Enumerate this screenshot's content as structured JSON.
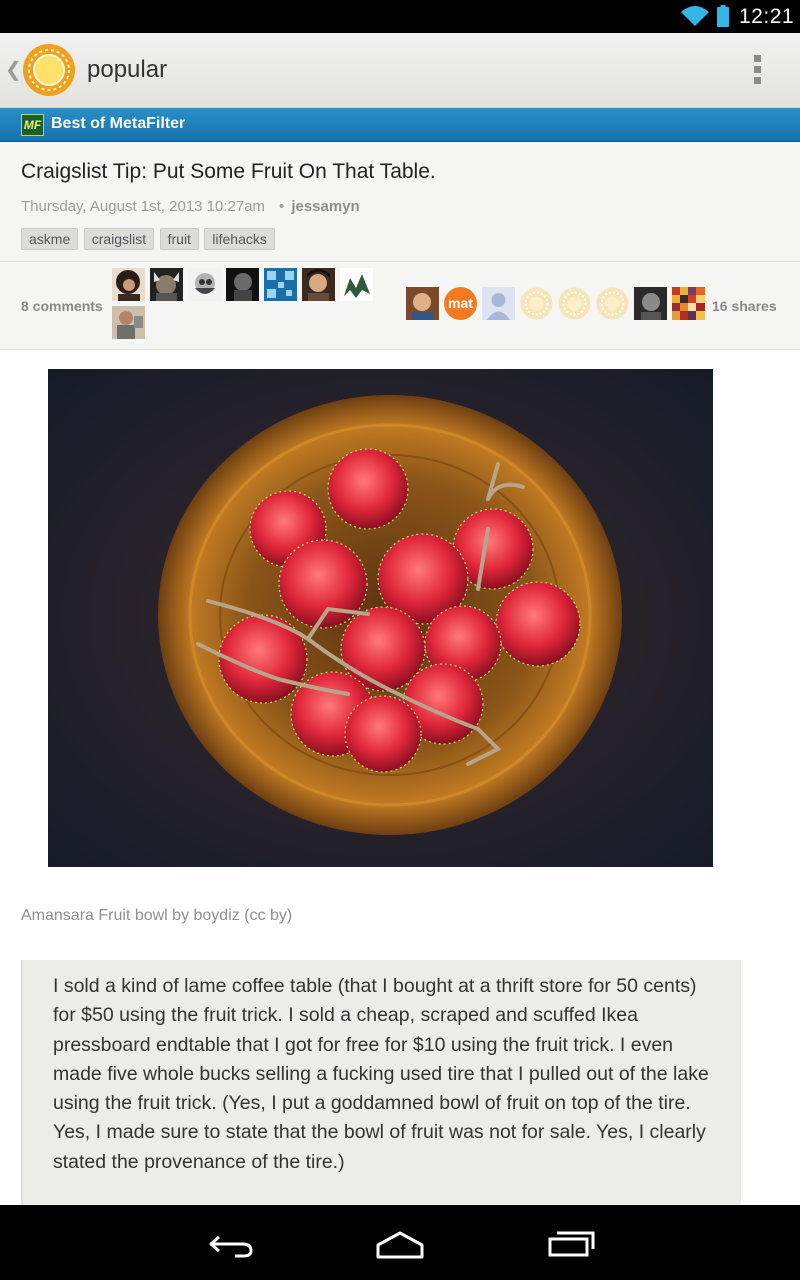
{
  "status_bar": {
    "time": "12:21",
    "icons": [
      "wifi-icon",
      "battery-icon"
    ]
  },
  "action_bar": {
    "title": "popular",
    "icons": [
      "up-caret-icon",
      "app-sun-logo-icon",
      "overflow-menu-icon"
    ]
  },
  "source": {
    "logo_text": "MF",
    "name": "Best of MetaFilter"
  },
  "article": {
    "headline": "Craigslist Tip: Put Some Fruit On That Table.",
    "date": "Thursday, August 1st, 2013 10:27am",
    "separator": "•",
    "author": "jessamyn",
    "tags": [
      "askme",
      "craigslist",
      "fruit",
      "lifehacks"
    ]
  },
  "social": {
    "comments_label": "8 comments",
    "shares_label": "16 shares",
    "share_avatar_text": "mat"
  },
  "image": {
    "caption": "Amansara Fruit bowl by boydiz (cc by)",
    "description_icon": "fruit-bowl-photo"
  },
  "quote": {
    "text": "I sold a kind of lame coffee table (that I bought at a thrift store for 50 cents) for $50 using the fruit trick. I sold a cheap, scraped and scuffed Ikea pressboard endtable that I got for free for $10 using the fruit trick. I even made five whole bucks selling a fucking used tire that I pulled out of the lake using the fruit trick. (Yes, I put a goddamned bowl of fruit on top of the tire. Yes, I made sure to state that the bowl of fruit was not for sale. Yes, I clearly stated the provenance of the tire.)"
  },
  "nav_bar": {
    "icons": [
      "back-icon",
      "home-icon",
      "recent-apps-icon"
    ]
  },
  "colors": {
    "source_bar": "#1f80bd",
    "action_bar": "#e8e8e5",
    "quote_bg": "#ececea"
  }
}
